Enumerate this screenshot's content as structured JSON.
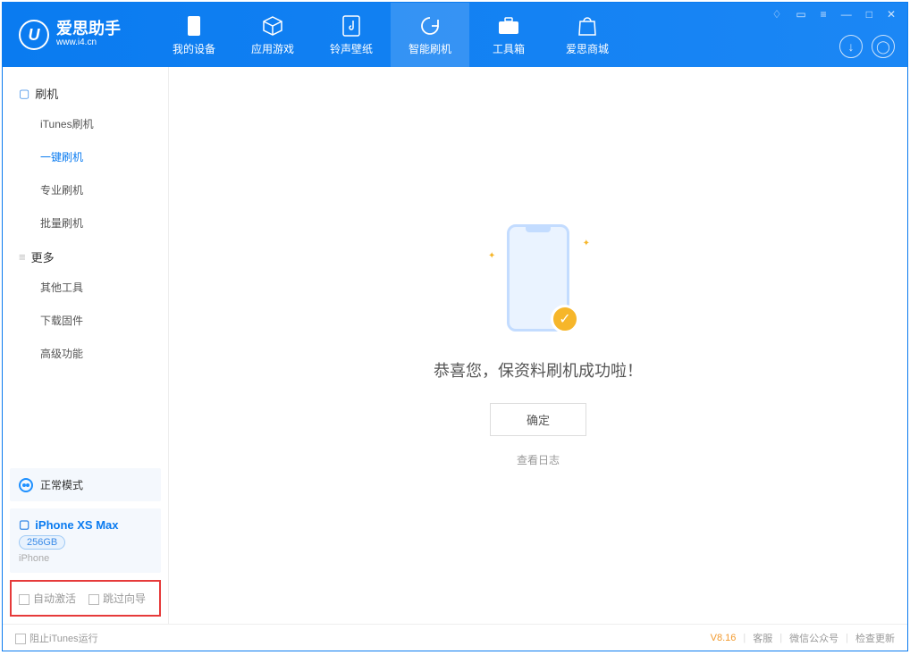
{
  "logo": {
    "title": "爱思助手",
    "subtitle": "www.i4.cn",
    "mark": "U"
  },
  "tabs": [
    {
      "label": "我的设备"
    },
    {
      "label": "应用游戏"
    },
    {
      "label": "铃声壁纸"
    },
    {
      "label": "智能刷机"
    },
    {
      "label": "工具箱"
    },
    {
      "label": "爱思商城"
    }
  ],
  "sidebar": {
    "group1": "刷机",
    "items1": [
      "iTunes刷机",
      "一键刷机",
      "专业刷机",
      "批量刷机"
    ],
    "group2": "更多",
    "items2": [
      "其他工具",
      "下载固件",
      "高级功能"
    ]
  },
  "mode": {
    "label": "正常模式"
  },
  "device": {
    "name": "iPhone XS Max",
    "storage": "256GB",
    "type": "iPhone"
  },
  "options": {
    "opt1": "自动激活",
    "opt2": "跳过向导"
  },
  "main": {
    "message": "恭喜您，保资料刷机成功啦！",
    "ok": "确定",
    "log": "查看日志"
  },
  "footer": {
    "block": "阻止iTunes运行",
    "version": "V8.16",
    "links": [
      "客服",
      "微信公众号",
      "检查更新"
    ]
  }
}
